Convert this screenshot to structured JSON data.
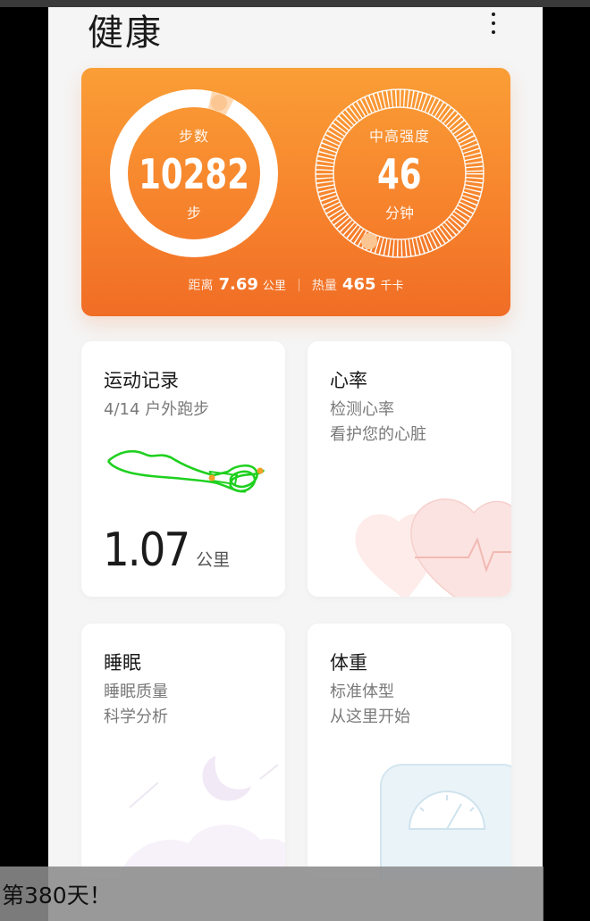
{
  "header": {
    "title": "健康"
  },
  "activity": {
    "steps_label": "步数",
    "steps_value": "10282",
    "steps_unit": "步",
    "intensity_label": "中高强度",
    "intensity_value": "46",
    "intensity_unit": "分钟",
    "distance_label": "距离",
    "distance_value": "7.69",
    "distance_unit": "公里",
    "calories_label": "热量",
    "calories_value": "465",
    "calories_unit": "千卡",
    "colors": {
      "gradient_top": "#fa9e36",
      "gradient_bottom": "#f06d25"
    }
  },
  "cards": {
    "exercise": {
      "title": "运动记录",
      "subtitle": "4/14 户外跑步",
      "distance_value": "1.07",
      "distance_unit": "公里",
      "route_color": "#1fd01f"
    },
    "heart": {
      "title": "心率",
      "line1": "检测心率",
      "line2": "看护您的心脏"
    },
    "sleep": {
      "title": "睡眠",
      "line1": "睡眠质量",
      "line2": "科学分析"
    },
    "weight": {
      "title": "体重",
      "line1": "标准体型",
      "line2": "从这里开始"
    }
  },
  "toast": {
    "text": "第380天！"
  }
}
